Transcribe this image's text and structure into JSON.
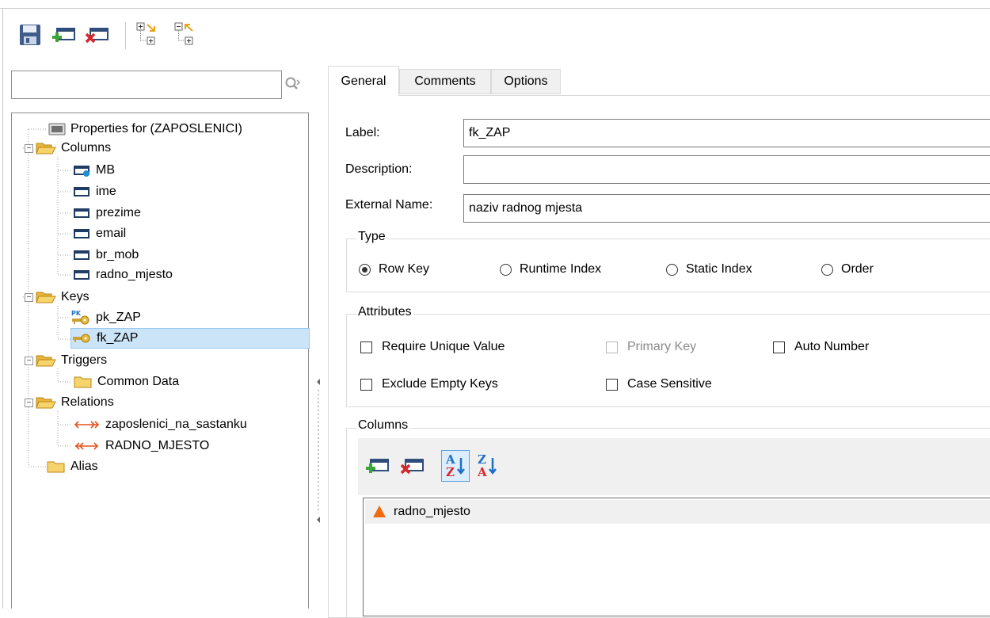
{
  "toolbar": {
    "buttons": [
      {
        "name": "save",
        "icon": "floppy-disk-icon"
      },
      {
        "name": "add-key",
        "icon": "add-row-icon"
      },
      {
        "name": "delete-key",
        "icon": "delete-row-icon"
      },
      {
        "name": "expand-all",
        "icon": "expand-tree-icon"
      },
      {
        "name": "collapse-all",
        "icon": "collapse-tree-icon"
      }
    ]
  },
  "search": {
    "value": "",
    "placeholder": ""
  },
  "tree": {
    "properties": "Properties for (ZAPOSLENICI)",
    "columns": "Columns",
    "col_mb": "MB",
    "col_ime": "ime",
    "col_prezime": "prezime",
    "col_email": "email",
    "col_br_mob": "br_mob",
    "col_radno_mjesto": "radno_mjesto",
    "keys": "Keys",
    "key_pk": "pk_ZAP",
    "key_fk": "fk_ZAP",
    "triggers": "Triggers",
    "common_data": "Common Data",
    "relations": "Relations",
    "rel_1": "zaposlenici_na_sastanku",
    "rel_2": "RADNO_MJESTO",
    "alias": "Alias",
    "pk_badge": "PK"
  },
  "tabs": {
    "general": "General",
    "comments": "Comments",
    "options": "Options"
  },
  "form": {
    "label_label": "Label:",
    "label_value": "fk_ZAP",
    "description_label": "Description:",
    "description_value": "",
    "external_label": "External Name:",
    "external_value": "naziv radnog mjesta"
  },
  "type_group": {
    "title": "Type",
    "options": [
      "Row Key",
      "Runtime Index",
      "Static Index",
      "Order"
    ],
    "selected": "Row Key"
  },
  "attributes": {
    "title": "Attributes",
    "require_unique": "Require Unique Value",
    "primary_key": "Primary Key",
    "auto_number": "Auto Number",
    "exclude_empty": "Exclude Empty Keys",
    "case_sensitive": "Case Sensitive"
  },
  "columns_group": {
    "title": "Columns",
    "sort_asc_a": "A",
    "sort_asc_z": "Z",
    "sort_desc_z": "Z",
    "sort_desc_a": "A",
    "rows": [
      "radno_mjesto"
    ]
  },
  "colors": {
    "selection": "#cce4f7",
    "folder": "#f5c448",
    "accent_blue": "#1e6fc7",
    "warning_orange": "#f26a0f"
  }
}
